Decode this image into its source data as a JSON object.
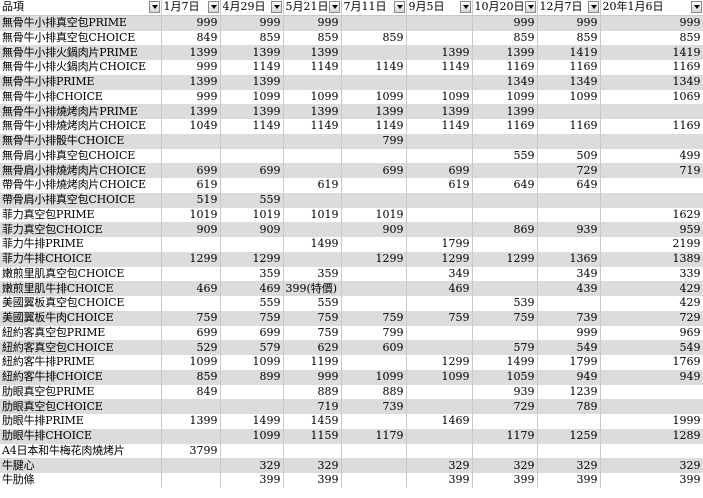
{
  "columns": [
    "品項",
    "1月7日",
    "4月29日",
    "5月21日",
    "7月11日",
    "9月5日",
    "10月20日",
    "12月7日",
    "20年1月6日"
  ],
  "rows": [
    [
      "無骨牛小排真空包PRIME",
      "999",
      "999",
      "999",
      "",
      "",
      "999",
      "999",
      "999"
    ],
    [
      "無骨牛小排真空包CHOICE",
      "849",
      "859",
      "859",
      "859",
      "",
      "859",
      "859",
      "859"
    ],
    [
      "無骨牛小排火鍋肉片PRIME",
      "1399",
      "1399",
      "1399",
      "",
      "1399",
      "1399",
      "1419",
      "1419"
    ],
    [
      "無骨牛小排火鍋肉片CHOICE",
      "999",
      "1149",
      "1149",
      "1149",
      "1149",
      "1169",
      "1169",
      "1169"
    ],
    [
      "無骨牛小排PRIME",
      "1399",
      "1399",
      "",
      "",
      "",
      "1349",
      "1349",
      "1349"
    ],
    [
      "無骨牛小排CHOICE",
      "999",
      "1099",
      "1099",
      "1099",
      "1099",
      "1099",
      "1099",
      "1069"
    ],
    [
      "無骨牛小排燒烤肉片PRIME",
      "1399",
      "1399",
      "1399",
      "1399",
      "1399",
      "1399",
      "",
      ""
    ],
    [
      "無骨牛小排燒烤肉片CHOICE",
      "1049",
      "1149",
      "1149",
      "1149",
      "1149",
      "1169",
      "1169",
      "1169"
    ],
    [
      "無骨牛小排骰牛CHOICE",
      "",
      "",
      "",
      "799",
      "",
      "",
      "",
      ""
    ],
    [
      "無骨肩小排真空包CHOICE",
      "",
      "",
      "",
      "",
      "",
      "559",
      "509",
      "499"
    ],
    [
      "無骨肩小排燒烤肉片CHOICE",
      "699",
      "699",
      "",
      "699",
      "699",
      "",
      "729",
      "719"
    ],
    [
      "帶骨牛小排燒烤肉片CHOICE",
      "619",
      "",
      "619",
      "",
      "619",
      "649",
      "649",
      ""
    ],
    [
      "帶骨肩小排真空包CHOICE",
      "519",
      "559",
      "",
      "",
      "",
      "",
      "",
      ""
    ],
    [
      "菲力真空包PRIME",
      "1019",
      "1019",
      "1019",
      "1019",
      "",
      "",
      "",
      "1629"
    ],
    [
      "菲力真空包CHOICE",
      "909",
      "909",
      "",
      "909",
      "",
      "869",
      "939",
      "959"
    ],
    [
      "菲力牛排PRIME",
      "",
      "",
      "1499",
      "",
      "1799",
      "",
      "",
      "2199"
    ],
    [
      "菲力牛排CHOICE",
      "1299",
      "1299",
      "",
      "1299",
      "1299",
      "1299",
      "1369",
      "1389"
    ],
    [
      "嫩煎里肌真空包CHOICE",
      "",
      "359",
      "359",
      "",
      "349",
      "",
      "349",
      "339"
    ],
    [
      "嫩煎里肌牛排CHOICE",
      "469",
      "469",
      "399(特價)",
      "",
      "469",
      "",
      "439",
      "429"
    ],
    [
      "美國翼板真空包CHOICE",
      "",
      "559",
      "559",
      "",
      "",
      "539",
      "",
      "429"
    ],
    [
      "美國翼板牛肉CHOICE",
      "759",
      "759",
      "759",
      "759",
      "759",
      "759",
      "739",
      "729"
    ],
    [
      "紐約客真空包PRIME",
      "699",
      "699",
      "759",
      "799",
      "",
      "",
      "999",
      "969"
    ],
    [
      "紐約客真空包CHOICE",
      "529",
      "579",
      "629",
      "609",
      "",
      "579",
      "549",
      "549"
    ],
    [
      "紐約客牛排PRIME",
      "1099",
      "1099",
      "1199",
      "",
      "1299",
      "1499",
      "1799",
      "1769"
    ],
    [
      "紐約客牛排CHOICE",
      "859",
      "899",
      "999",
      "1099",
      "1099",
      "1059",
      "949",
      "949"
    ],
    [
      "肋眼真空包PRIME",
      "849",
      "",
      "889",
      "889",
      "",
      "939",
      "1239",
      ""
    ],
    [
      "肋眼真空包CHOICE",
      "",
      "",
      "719",
      "739",
      "",
      "729",
      "789",
      ""
    ],
    [
      "肋眼牛排PRIME",
      "1399",
      "1499",
      "1459",
      "",
      "1469",
      "",
      "",
      "1999"
    ],
    [
      "肋眼牛排CHOICE",
      "",
      "1099",
      "1159",
      "1179",
      "",
      "1179",
      "1259",
      "1289"
    ],
    [
      "A4日本和牛梅花肉燒烤片",
      "3799",
      "",
      "",
      "",
      "",
      "",
      "",
      ""
    ],
    [
      "牛腱心",
      "",
      "329",
      "329",
      "",
      "329",
      "329",
      "329",
      "329"
    ],
    [
      "牛肋條",
      "",
      "399",
      "399",
      "",
      "399",
      "399",
      "399",
      "399"
    ]
  ]
}
